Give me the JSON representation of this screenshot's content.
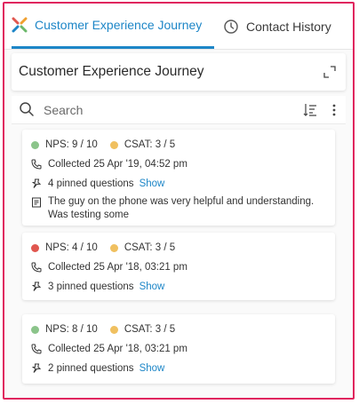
{
  "tabs": [
    {
      "label": "Customer Experience Journey",
      "active": true,
      "icon": "journey-logo-icon"
    },
    {
      "label": "Contact History",
      "active": false,
      "icon": "clock-icon"
    }
  ],
  "panel": {
    "title": "Customer Experience Journey",
    "expand_icon": "expand-icon"
  },
  "search": {
    "placeholder": "Search",
    "sort_icon": "sort-icon",
    "more_icon": "more-vertical-icon"
  },
  "colors": {
    "accent": "#1d86c7",
    "frame": "#e0245e",
    "nps_good": "#8bc48a",
    "nps_bad": "#e0574f",
    "csat": "#f0c060"
  },
  "cards": [
    {
      "nps": "NPS: 9 / 10",
      "nps_status": "good",
      "csat": "CSAT: 3 / 5",
      "collected": "Collected 25 Apr '19, 04:52 pm",
      "pinned": "4 pinned questions",
      "show": "Show",
      "comment": "The guy on the phone was very helpful and understanding. Was testing some"
    },
    {
      "nps": "NPS: 4 / 10",
      "nps_status": "bad",
      "csat": "CSAT: 3 / 5",
      "collected": "Collected 25 Apr '18, 03:21 pm",
      "pinned": "3 pinned questions",
      "show": "Show"
    },
    {
      "nps": "NPS: 8 / 10",
      "nps_status": "good",
      "csat": "CSAT: 3 / 5",
      "collected": "Collected 25 Apr '18, 03:21 pm",
      "pinned": "2 pinned questions",
      "show": "Show"
    }
  ]
}
